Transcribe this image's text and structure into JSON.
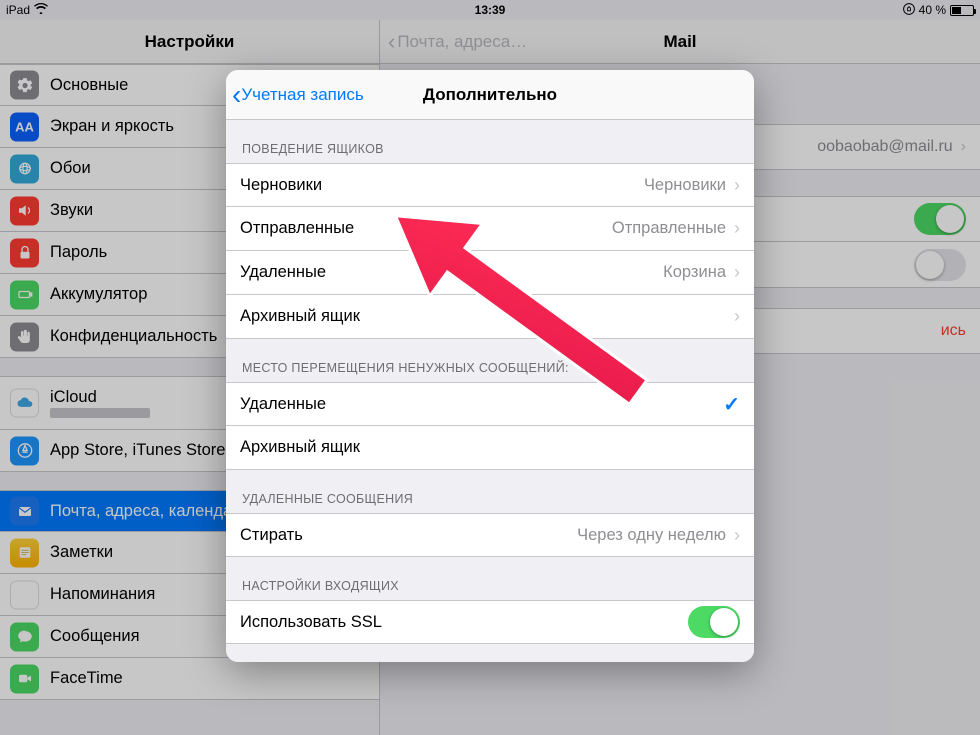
{
  "statusbar": {
    "device": "iPad",
    "time": "13:39",
    "battery_pct": "40 %"
  },
  "left": {
    "title": "Настройки",
    "items": {
      "general": "Основные",
      "display": "Экран и яркость",
      "wallpaper": "Обои",
      "sounds": "Звуки",
      "passcode": "Пароль",
      "battery": "Аккумулятор",
      "privacy": "Конфиденциальность",
      "icloud": "iCloud",
      "appstore": "App Store, iTunes Store",
      "mail": "Почта, адреса, календари",
      "notes": "Заметки",
      "reminders": "Напоминания",
      "messages": "Сообщения",
      "facetime": "FaceTime"
    }
  },
  "right": {
    "back": "Почта, адреса…",
    "title": "Mail",
    "account_email": "oobaobab@mail.ru",
    "delete_text": "ись"
  },
  "modal": {
    "back": "Учетная запись",
    "title": "Дополнительно",
    "sec1": "Поведение ящиков",
    "drafts_label": "Черновики",
    "drafts_val": "Черновики",
    "sent_label": "Отправленные",
    "sent_val": "Отправленные",
    "deleted_label": "Удаленные",
    "deleted_val": "Корзина",
    "archive_label": "Архивный ящик",
    "sec2": "Место перемещения ненужных сообщений:",
    "opt_deleted": "Удаленные",
    "opt_archive": "Архивный ящик",
    "sec3": "Удаленные сообщения",
    "erase_label": "Стирать",
    "erase_val": "Через одну неделю",
    "sec4": "Настройки входящих",
    "ssl_label": "Использовать SSL"
  }
}
